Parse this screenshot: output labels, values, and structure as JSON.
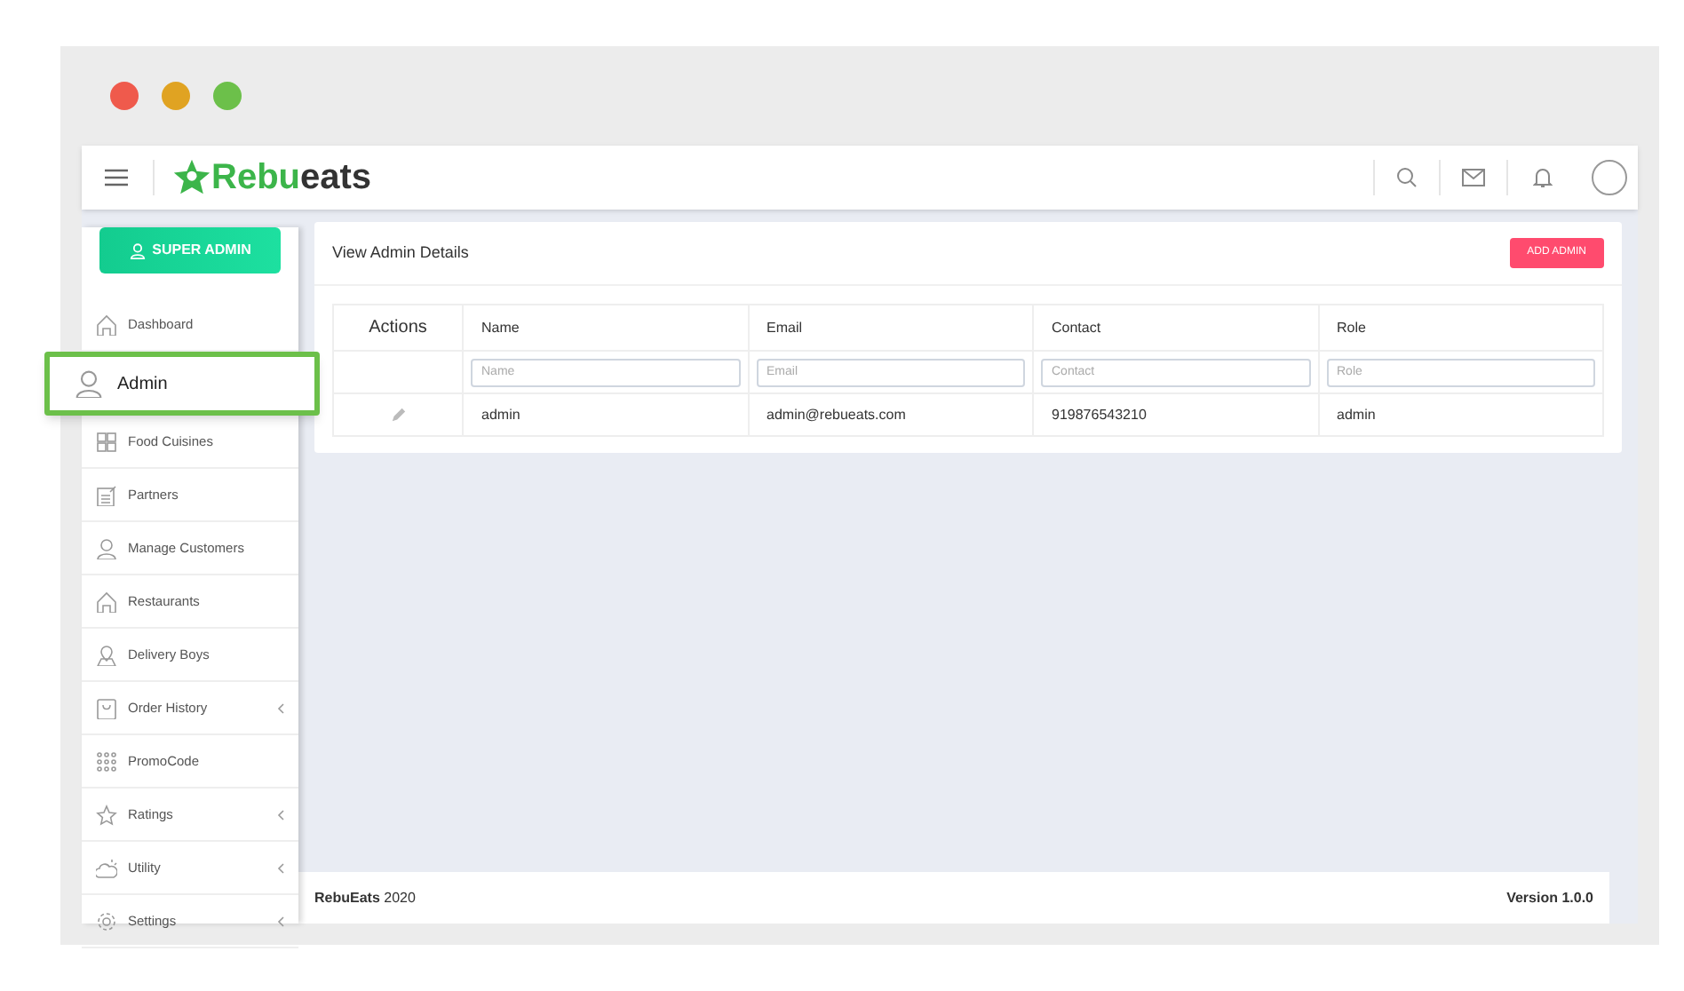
{
  "header": {
    "logo": {
      "part1": "Rebu",
      "part2": "eats"
    }
  },
  "sidebar": {
    "role_button": "SUPER ADMIN",
    "items": [
      {
        "label": "Dashboard",
        "selected": false,
        "expandable": false
      },
      {
        "label": "Admin",
        "selected": true,
        "expandable": false
      },
      {
        "label": "Food Cuisines",
        "selected": false,
        "expandable": false
      },
      {
        "label": "Partners",
        "selected": false,
        "expandable": false
      },
      {
        "label": "Manage Customers",
        "selected": false,
        "expandable": false
      },
      {
        "label": "Restaurants",
        "selected": false,
        "expandable": false
      },
      {
        "label": "Delivery Boys",
        "selected": false,
        "expandable": false
      },
      {
        "label": "Order History",
        "selected": false,
        "expandable": true
      },
      {
        "label": "PromoCode",
        "selected": false,
        "expandable": false
      },
      {
        "label": "Ratings",
        "selected": false,
        "expandable": true
      },
      {
        "label": "Utility",
        "selected": false,
        "expandable": true
      },
      {
        "label": "Settings",
        "selected": false,
        "expandable": true
      }
    ]
  },
  "card": {
    "title": "View Admin Details",
    "add_button": "ADD ADMIN",
    "table": {
      "columns": [
        "Actions",
        "Name",
        "Email",
        "Contact",
        "Role"
      ],
      "filters": [
        {
          "placeholder": "Name"
        },
        {
          "placeholder": "Email"
        },
        {
          "placeholder": "Contact"
        },
        {
          "placeholder": "Role"
        }
      ],
      "rows": [
        {
          "cells": [
            "",
            "admin",
            "admin@rebueats.com",
            "919876543210",
            "admin"
          ]
        }
      ]
    }
  },
  "footer": {
    "copyright": "**RebuEats** 2020",
    "version": "Version 1.0.0"
  }
}
